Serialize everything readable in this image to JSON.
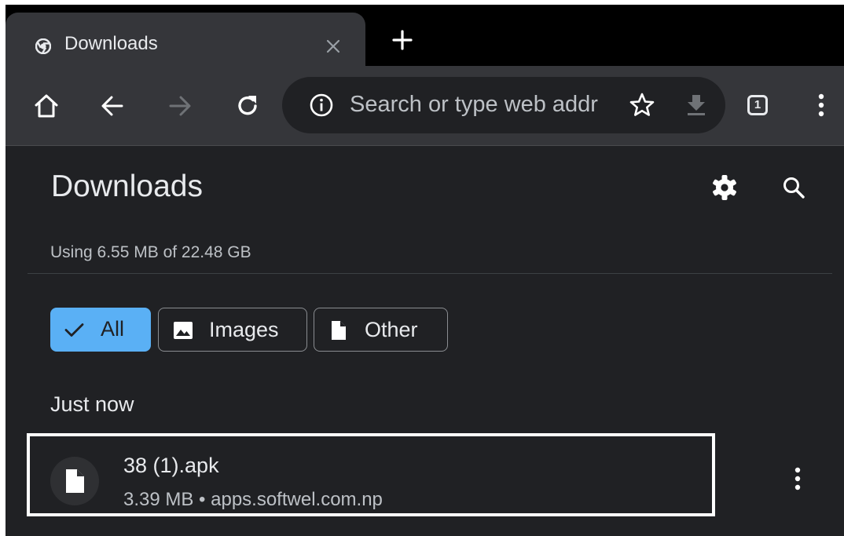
{
  "tab": {
    "title": "Downloads",
    "favicon": "chrome-logo-icon",
    "close_icon": "close-icon"
  },
  "toolbar": {
    "home_icon": "home-icon",
    "back_icon": "back-arrow-icon",
    "forward_icon": "forward-arrow-icon",
    "reload_icon": "reload-icon",
    "omnibox_placeholder": "Search or type web addr",
    "info_icon": "info-icon",
    "bookmark_icon": "star-icon",
    "download_icon": "download-icon",
    "tab_count": "1",
    "menu_icon": "more-vert-icon"
  },
  "page": {
    "title": "Downloads",
    "storage_text": "Using 6.55 MB of 22.48 GB",
    "settings_icon": "gear-icon",
    "search_icon": "search-icon"
  },
  "filters": [
    {
      "label": "All",
      "icon": "check-icon",
      "selected": true
    },
    {
      "label": "Images",
      "icon": "image-icon",
      "selected": false
    },
    {
      "label": "Other",
      "icon": "file-icon",
      "selected": false
    }
  ],
  "sections": [
    {
      "heading": "Just now",
      "items": [
        {
          "name": "38 (1).apk",
          "meta": "3.39 MB • apps.softwel.com.np",
          "icon": "file-icon",
          "menu_icon": "more-vert-icon"
        }
      ]
    }
  ],
  "colors": {
    "background": "#202124",
    "toolbar": "#35363a",
    "accent": "#5ab0f5",
    "text": "#e8eaed",
    "highlight": "#ffffff"
  }
}
